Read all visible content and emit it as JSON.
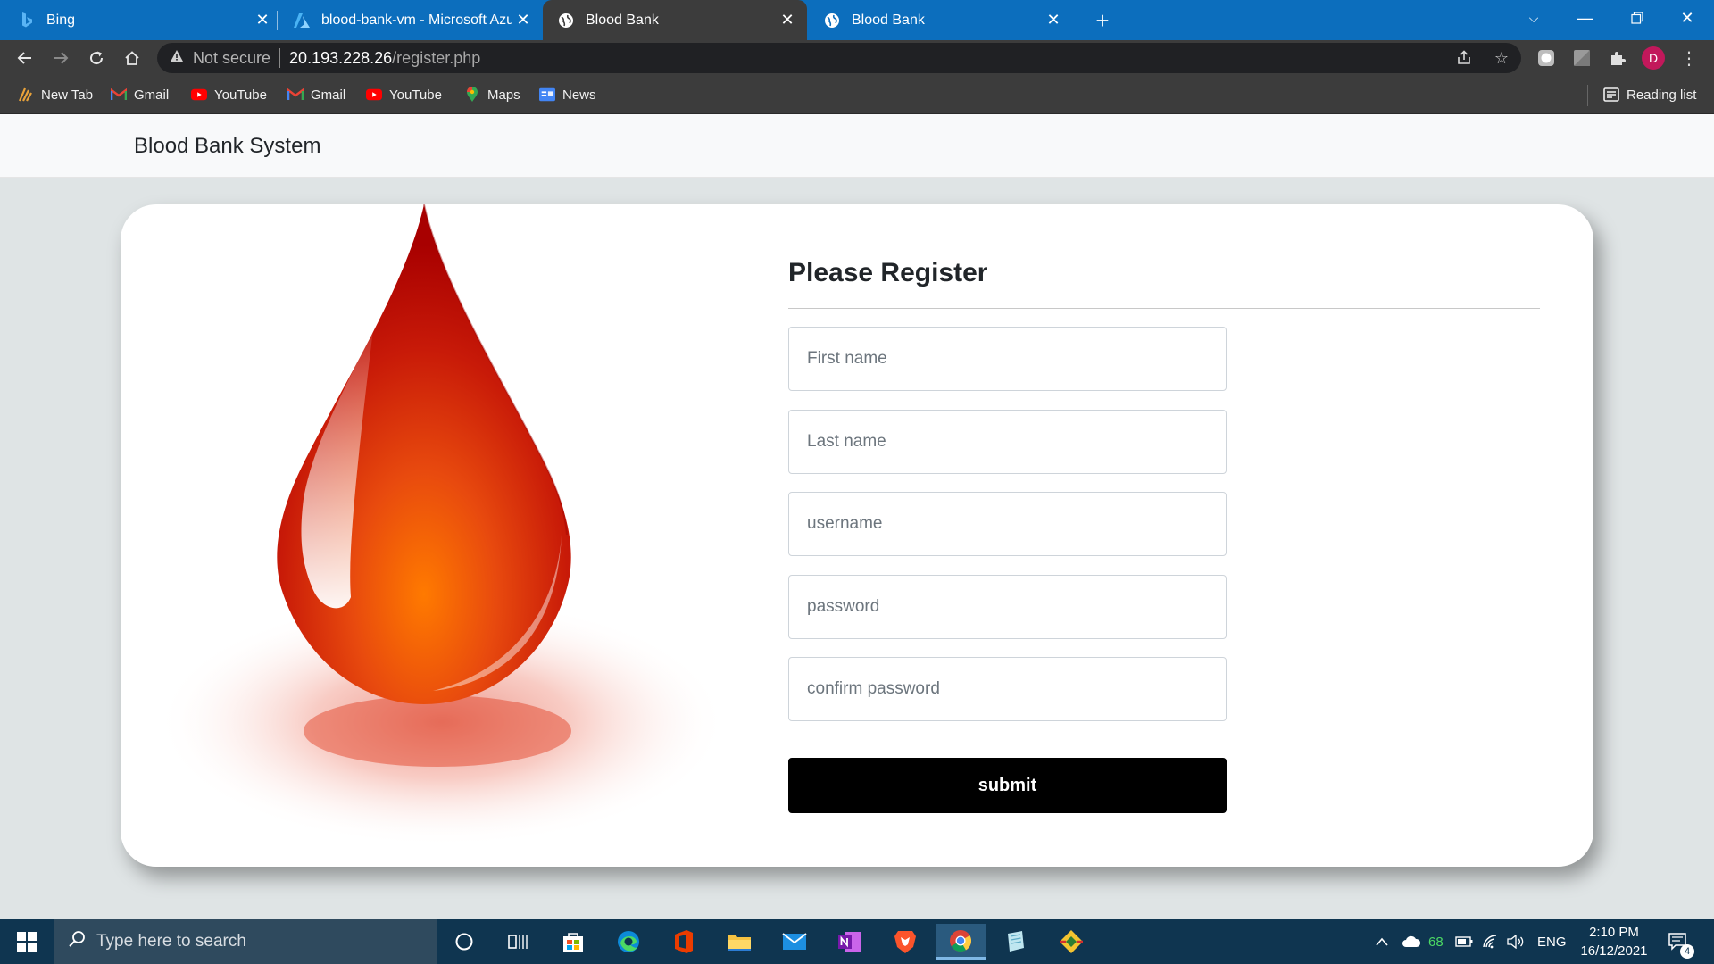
{
  "browser": {
    "tabs": [
      {
        "title": "Bing",
        "icon": "bing-icon"
      },
      {
        "title": "blood-bank-vm - Microsoft Azure",
        "icon": "azure-icon"
      },
      {
        "title": "Blood Bank",
        "icon": "globe-icon"
      },
      {
        "title": "Blood Bank",
        "icon": "globe-icon"
      }
    ],
    "address": {
      "security_label": "Not secure",
      "host": "20.193.228.26",
      "path": "/register.php"
    },
    "profile_initial": "D",
    "bookmarks": [
      {
        "label": "New Tab",
        "icon": "new-tab-icon"
      },
      {
        "label": "Gmail",
        "icon": "gmail-icon"
      },
      {
        "label": "YouTube",
        "icon": "youtube-icon"
      },
      {
        "label": "Gmail",
        "icon": "gmail-icon"
      },
      {
        "label": "YouTube",
        "icon": "youtube-icon"
      },
      {
        "label": "Maps",
        "icon": "maps-icon"
      },
      {
        "label": "News",
        "icon": "news-icon"
      }
    ],
    "reading_list": "Reading list"
  },
  "page": {
    "brand": "Blood Bank System",
    "form": {
      "title": "Please Register",
      "fields": [
        {
          "placeholder": "First name"
        },
        {
          "placeholder": "Last name"
        },
        {
          "placeholder": "username"
        },
        {
          "placeholder": "password"
        },
        {
          "placeholder": "confirm password"
        }
      ],
      "submit_label": "submit"
    }
  },
  "taskbar": {
    "search_placeholder": "Type here to search",
    "battery_percent": "68",
    "language": "ENG",
    "time": "2:10 PM",
    "date": "16/12/2021",
    "notification_count": "4"
  },
  "colors": {
    "tabbar": "#0c6ebd",
    "chrome_dark": "#3c3c3c",
    "page_bg": "#dfe4e5",
    "button": "#000000",
    "taskbar": "#0f3550"
  }
}
